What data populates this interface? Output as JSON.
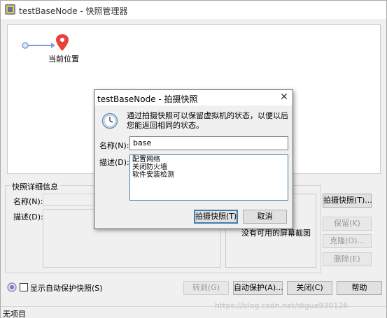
{
  "window": {
    "title": "testBaseNode - 快照管理器"
  },
  "tree": {
    "current_position_label": "当前位置"
  },
  "details": {
    "group_title": "快照详细信息",
    "name_label": "名称(N):",
    "desc_label": "描述(D):",
    "no_screenshot_text": "没有可用的屏幕截图"
  },
  "side_buttons": {
    "take_snapshot": "拍摄快照(T)...",
    "keep": "保留(K)",
    "clone": "克隆(O)...",
    "delete": "删除(E)"
  },
  "bottom": {
    "auto_protect_checkbox_label": "显示自动保护快照(S)",
    "goto": "转到(G)",
    "auto_protect": "自动保护(A)...",
    "close": "关闭(C)",
    "help": "帮助"
  },
  "status": {
    "text": "无项目"
  },
  "watermark": "https://blog.csdn.net/digua930126",
  "dialog": {
    "title": "testBaseNode - 拍摄快照",
    "info": "通过拍摄快照可以保留虚拟机的状态，以便以后您能返回相同的状态。",
    "name_label": "名称(N):",
    "name_value": "base",
    "desc_label": "描述(D):",
    "desc_value": "配置网络\n关闭防火墙\n软件安装检测",
    "take_button": "拍摄快照(T)",
    "cancel_button": "取消"
  },
  "colors": {
    "accent": "#3c7fb1",
    "pin": "#e8413a",
    "timeline": "#7f9fd2"
  }
}
